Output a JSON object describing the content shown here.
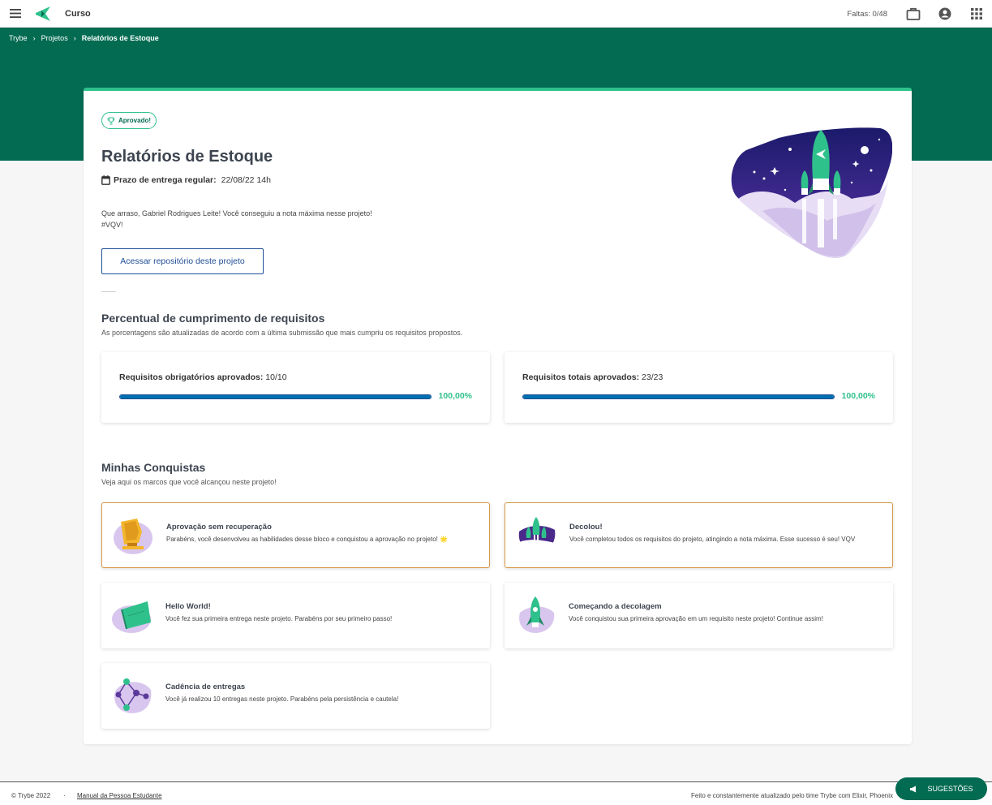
{
  "topbar": {
    "course_title": "Curso",
    "faltas": "Faltas: 0/48",
    "icons": [
      "menu-icon",
      "trybe-logo",
      "briefcase-icon",
      "account-icon",
      "apps-icon"
    ]
  },
  "breadcrumb": {
    "items": [
      "Trybe",
      "Projetos",
      "Relatórios de Estoque"
    ],
    "separator": "›"
  },
  "project": {
    "badge": "Aprovado!",
    "title": "Relatórios de Estoque",
    "deadline_label": "Prazo de entrega regular:",
    "deadline_value": "22/08/22 14h",
    "congrats_line1": "Que arraso, Gabriel Rodrigues Leite! Você conseguiu a nota máxima nesse projeto!",
    "congrats_line2": "#VQV!",
    "repo_button": "Acessar repositório deste projeto"
  },
  "requirements": {
    "title": "Percentual de cumprimento de requisitos",
    "subtitle": "As porcentagens são atualizadas de acordo com a última submissão que mais cumpriu os requisitos propostos.",
    "boxes": [
      {
        "label": "Requisitos obrigatórios aprovados:",
        "value": "10/10",
        "percent_text": "100,00%",
        "progress": 1.0
      },
      {
        "label": "Requisitos totais aprovados:",
        "value": "23/23",
        "percent_text": "100,00%",
        "progress": 1.0
      }
    ]
  },
  "achievements": {
    "title": "Minhas Conquistas",
    "subtitle": "Veja aqui os marcos que você alcançou neste projeto!",
    "items": [
      {
        "title": "Aprovação sem recuperação",
        "desc": "Parabéns, você desenvolveu as habilidades desse bloco e conquistou a aprovação no projeto! 🌟",
        "icon": "gold-medal-icon"
      },
      {
        "title": "Decolou!",
        "desc": "Você completou todos os requisitos do projeto, atingindo a nota máxima. Esse sucesso é seu! VQV",
        "icon": "rockets-launch-icon"
      },
      {
        "title": "Hello World!",
        "desc": "Você fez sua primeira entrega neste projeto. Parabéns por seu primeiro passo!",
        "icon": "flag-icon"
      },
      {
        "title": "Começando a decolagem",
        "desc": "Você conquistou sua primeira aprovação em um requisito neste projeto! Continue assim!",
        "icon": "rocket-icon"
      },
      {
        "title": "Cadência de entregas",
        "desc": "Você já realizou 10 entregas neste projeto. Parabéns pela persistência e cautela!",
        "icon": "network-icon"
      }
    ]
  },
  "footer": {
    "copyright": "© Trybe 2022",
    "dot": "·",
    "manual": "Manual da Pessoa Estudante",
    "made_by": "Feito e constantemente atualizado pelo time Trybe com Elixir, Phoenix"
  },
  "suggestions_button": "SUGESTÕES",
  "colors": {
    "brand_green": "#036b52",
    "accent_green": "#2fc18c",
    "progress_blue": "#0070b0",
    "gold_border": "#d99a4a"
  }
}
